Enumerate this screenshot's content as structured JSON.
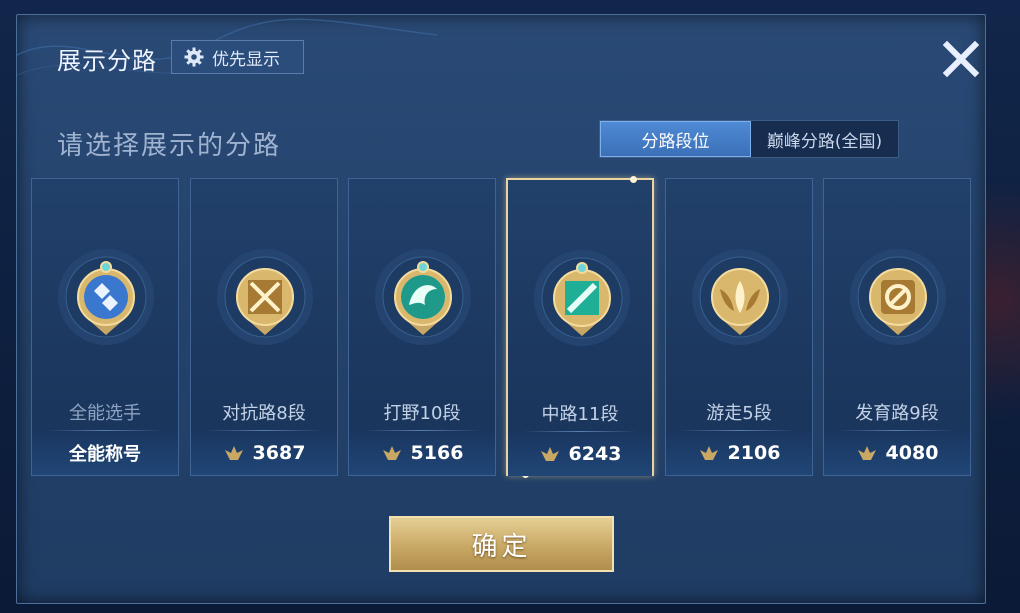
{
  "header": {
    "title": "展示分路",
    "priority_label": "优先显示"
  },
  "subtitle": "请选择展示的分路",
  "tabs": [
    {
      "label": "分路段位",
      "active": true
    },
    {
      "label": "巅峰分路(全国)",
      "active": false
    }
  ],
  "cards": [
    {
      "name": "全能选手",
      "footer": "全能称号",
      "score": null,
      "emblem": "all-round-emblem-icon",
      "selected": false
    },
    {
      "name": "对抗路8段",
      "footer": "3687",
      "score": 3687,
      "emblem": "clash-lane-emblem-icon",
      "selected": false
    },
    {
      "name": "打野10段",
      "footer": "5166",
      "score": 5166,
      "emblem": "jungle-emblem-icon",
      "selected": false
    },
    {
      "name": "中路11段",
      "footer": "6243",
      "score": 6243,
      "emblem": "mid-lane-emblem-icon",
      "selected": true
    },
    {
      "name": "游走5段",
      "footer": "2106",
      "score": 2106,
      "emblem": "roam-emblem-icon",
      "selected": false
    },
    {
      "name": "发育路9段",
      "footer": "4080",
      "score": 4080,
      "emblem": "farm-lane-emblem-icon",
      "selected": false
    }
  ],
  "confirm_label": "确定",
  "colors": {
    "gold": "#c9a865",
    "tab_active": "#3b70b8",
    "panel": "#24436c",
    "selection_border": "#e9d3a1"
  }
}
